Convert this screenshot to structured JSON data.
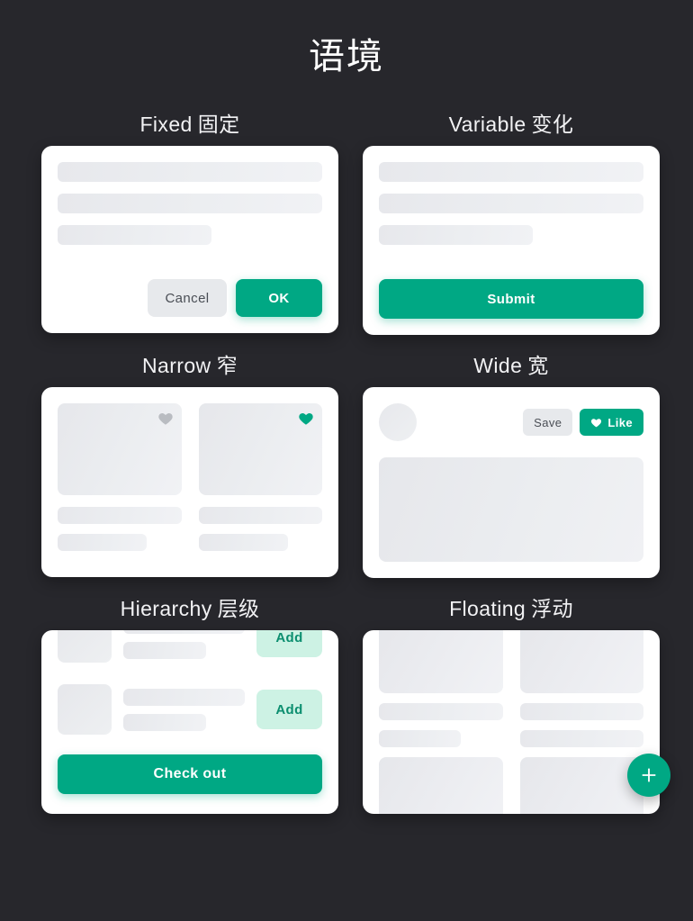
{
  "page": {
    "title": "语境",
    "background_color": "#27272c",
    "accent_color": "#00a884",
    "accent_soft_color": "#cdf2e4",
    "accent_soft_text_color": "#0b8e6f",
    "neutral_button_color": "#e7e9ec",
    "card_color": "#ffffff"
  },
  "sections": [
    {
      "id": "fixed",
      "label_en": "Fixed",
      "label_cn": "固定",
      "card": {
        "type": "dialog",
        "skeleton_rows": [
          "full",
          "full",
          "half"
        ],
        "buttons": [
          {
            "name": "cancel-button",
            "label": "Cancel",
            "style": "secondary"
          },
          {
            "name": "ok-button",
            "label": "OK",
            "style": "primary"
          }
        ]
      }
    },
    {
      "id": "variable",
      "label_en": "Variable",
      "label_cn": "变化",
      "card": {
        "type": "form",
        "skeleton_rows": [
          "full",
          "full",
          "half"
        ],
        "buttons": [
          {
            "name": "submit-button",
            "label": "Submit",
            "style": "primary-block"
          }
        ]
      }
    },
    {
      "id": "narrow",
      "label_en": "Narrow",
      "label_cn": "窄",
      "card": {
        "type": "tile-grid",
        "tiles": [
          {
            "name": "tile-left",
            "favorite": false,
            "heart_color": "#b9bcc1"
          },
          {
            "name": "tile-right",
            "favorite": true,
            "heart_color": "#00a884"
          }
        ]
      }
    },
    {
      "id": "wide",
      "label_en": "Wide",
      "label_cn": "宽",
      "card": {
        "type": "wide-post",
        "buttons": [
          {
            "name": "save-button",
            "label": "Save",
            "style": "secondary"
          },
          {
            "name": "like-button",
            "label": "Like",
            "style": "primary",
            "icon": "heart-icon"
          }
        ]
      }
    },
    {
      "id": "hierarchy",
      "label_en": "Hierarchy",
      "label_cn": "层级",
      "card": {
        "type": "cart",
        "rows": [
          {
            "name": "cart-row-1",
            "add_label": "Add"
          },
          {
            "name": "cart-row-2",
            "add_label": "Add"
          }
        ],
        "primary_action": {
          "name": "check-out-button",
          "label": "Check out",
          "style": "primary-block"
        }
      }
    },
    {
      "id": "floating",
      "label_en": "Floating",
      "label_cn": "浮动",
      "card": {
        "type": "feed-grid",
        "columns": 2,
        "fab": {
          "name": "add-fab-button",
          "icon": "plus-icon",
          "label": "+"
        }
      }
    }
  ]
}
